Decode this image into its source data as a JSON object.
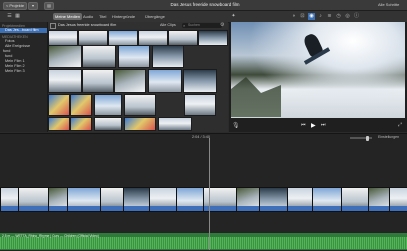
{
  "window": {
    "back_label": "< Projekte",
    "title": "Das Jesus freeride snowboard film",
    "share_label": "Alle Schritte"
  },
  "toolbar": {
    "tabs": [
      "Meine Medien",
      "Audio",
      "Titel",
      "Hintergründe",
      "Übergänge"
    ],
    "active_tab": "Meine Medien"
  },
  "library": {
    "heading_project": "Projektmedien",
    "project_item": "Das Jes...board film",
    "heading_libraries": "MEDIATHEKEN",
    "items": [
      "Fotos",
      "Alle Ereignisse",
      "fund",
      "fund",
      "Mein Film 1",
      "Mein Film 2",
      "Mein Film 3"
    ]
  },
  "browser": {
    "header_label": "Das Jesus freeride snowboard film",
    "filter_label": "Alle Clips",
    "search_placeholder": "Suchen"
  },
  "viewer": {
    "timecode": "2:04 / 3:40"
  },
  "timeline": {
    "settings_label": "Einstellungen",
    "audio_label": "2.5 m — WETTA_Rhino_Rhyme | Curs — Children (Official Video)"
  },
  "colors": {
    "accent": "#3d6fb3",
    "audio_track": "#2f7a3a",
    "clip_bar": "#3e6fb8"
  }
}
